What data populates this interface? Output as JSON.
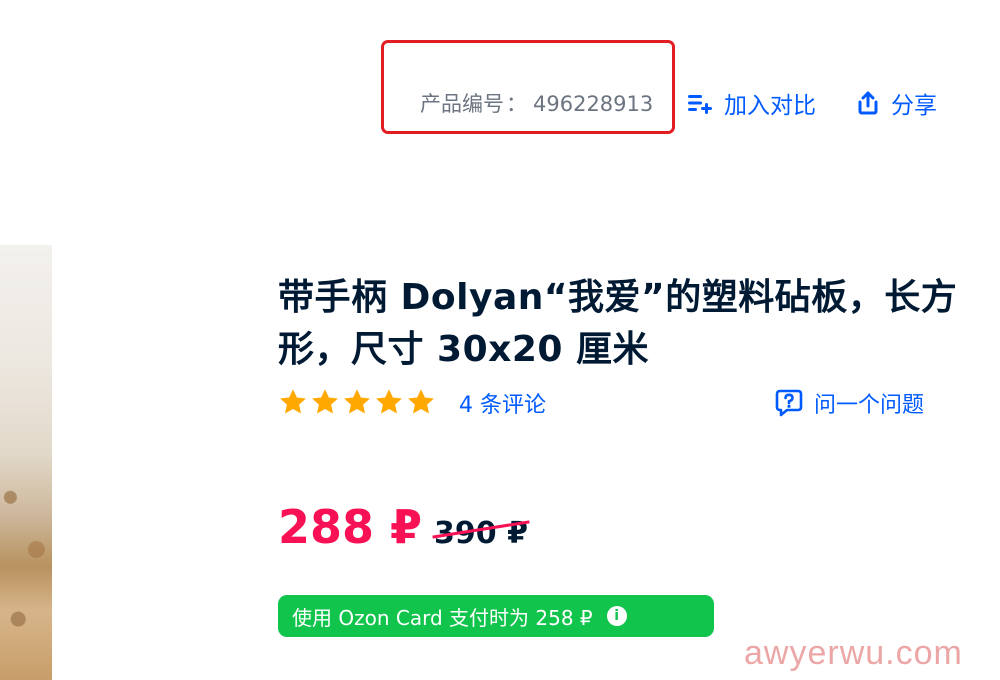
{
  "product": {
    "id_label": "产品编号",
    "id_separator": "：",
    "id_value": "496228913",
    "title": "带手柄 Dolyan“我爱”的塑料砧板，长方形，尺寸 30x20 厘米"
  },
  "actions": {
    "compare_label": "加入对比",
    "compare_icon": "add-to-compare-icon",
    "share_label": "分享",
    "share_icon": "share-icon"
  },
  "rating": {
    "stars": 5,
    "max_stars": 5,
    "reviews_label": "4 条评论",
    "ask_label": "问一个问题",
    "ask_icon": "question-bubble-icon"
  },
  "pricing": {
    "price": "288 ₽",
    "old_price": "390 ₽",
    "card_offer": "使用 Ozon Card 支付时为 258 ₽",
    "info_icon": "info-icon"
  },
  "colors": {
    "accent_blue": "#005bff",
    "price_pink": "#f91155",
    "badge_green": "#10c44c",
    "star_orange": "#ffa800",
    "highlight_red": "#e21c23",
    "title_dark": "#001a34"
  },
  "watermark": "awyerwu.com"
}
